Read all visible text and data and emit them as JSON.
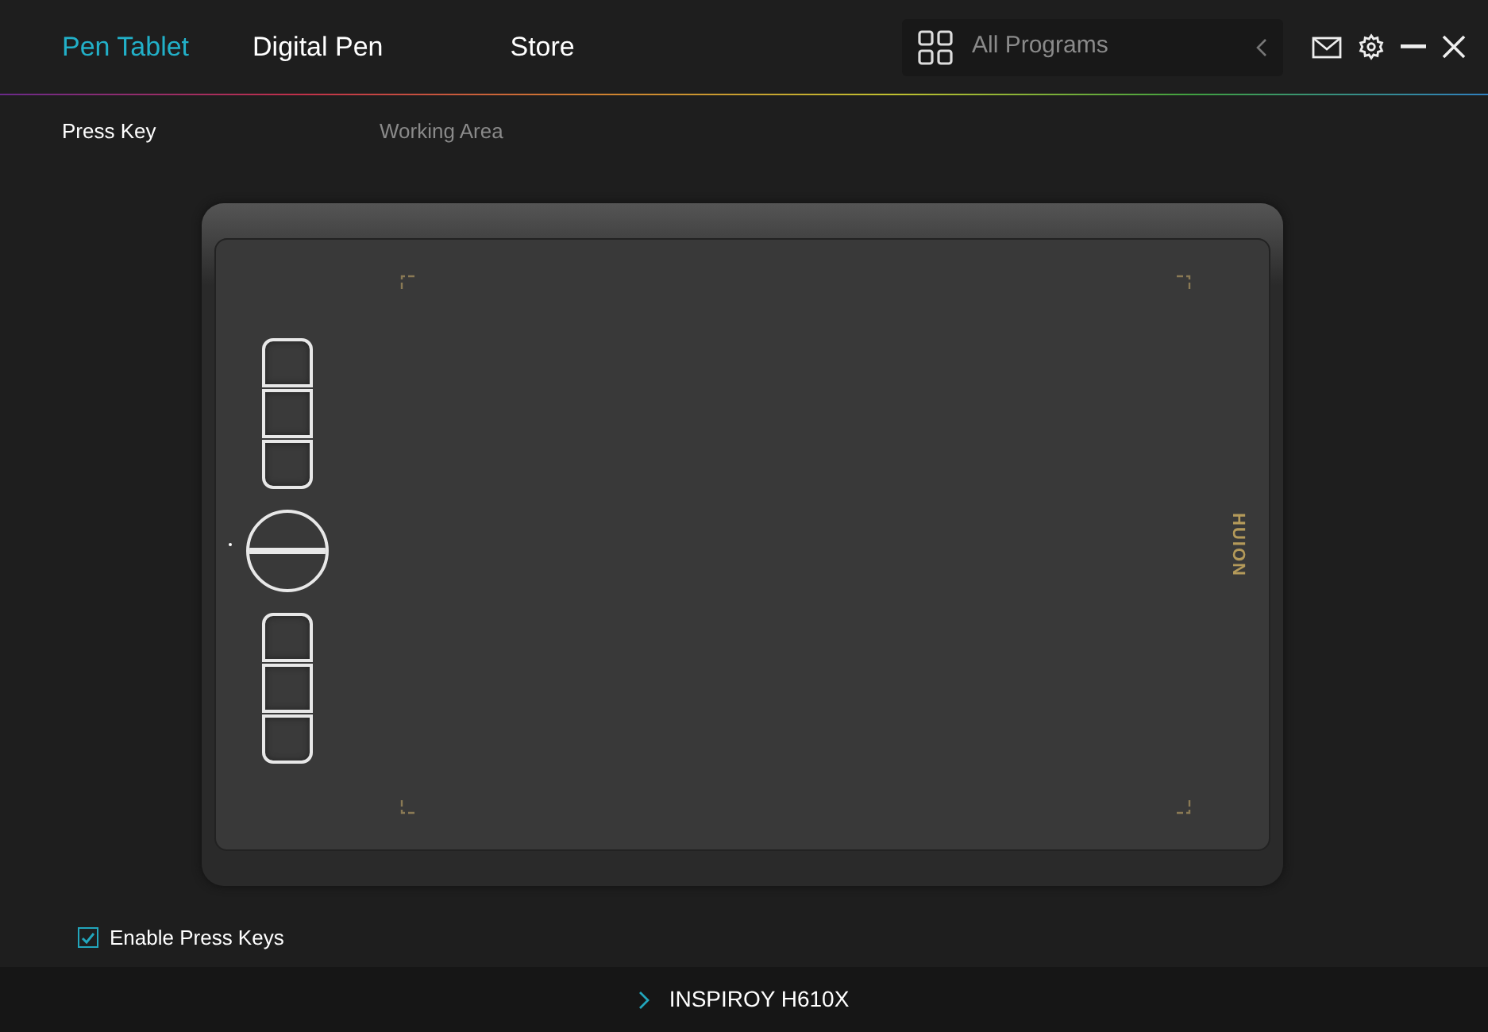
{
  "tabs": [
    {
      "label": "Pen Tablet",
      "selected": true
    },
    {
      "label": "Digital Pen",
      "selected": false
    },
    {
      "label": "Store",
      "selected": false
    }
  ],
  "program_selector": {
    "placeholder": "All Programs"
  },
  "subtabs": [
    {
      "label": "Press Key",
      "selected": true
    },
    {
      "label": "Working Area",
      "selected": false
    }
  ],
  "tablet": {
    "logo": "HUION"
  },
  "enable_press_keys": {
    "label": "Enable Press Keys",
    "checked": true
  },
  "status_bar": {
    "device": "INSPIROY H610X"
  }
}
